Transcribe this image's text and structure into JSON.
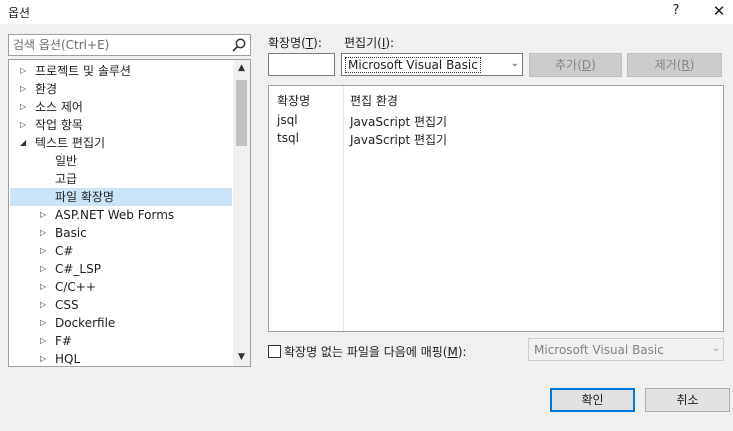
{
  "window": {
    "title": "옵션",
    "help_label": "?",
    "close_label": "✕"
  },
  "search": {
    "placeholder": "검색 옵션(Ctrl+E)",
    "value": ""
  },
  "tree": {
    "items": [
      {
        "label": "프로젝트 및 솔루션",
        "expanded": false,
        "level": 0
      },
      {
        "label": "환경",
        "expanded": false,
        "level": 0
      },
      {
        "label": "소스 제어",
        "expanded": false,
        "level": 0
      },
      {
        "label": "작업 항목",
        "expanded": false,
        "level": 0
      },
      {
        "label": "텍스트 편집기",
        "expanded": true,
        "level": 0
      },
      {
        "label": "일반",
        "level": 1
      },
      {
        "label": "고급",
        "level": 1
      },
      {
        "label": "파일 확장명",
        "level": 1,
        "selected": true
      },
      {
        "label": "ASP.NET Web Forms",
        "expanded": false,
        "level": 1
      },
      {
        "label": "Basic",
        "expanded": false,
        "level": 1
      },
      {
        "label": "C#",
        "expanded": false,
        "level": 1
      },
      {
        "label": "C#_LSP",
        "expanded": false,
        "level": 1
      },
      {
        "label": "C/C++",
        "expanded": false,
        "level": 1
      },
      {
        "label": "CSS",
        "expanded": false,
        "level": 1
      },
      {
        "label": "Dockerfile",
        "expanded": false,
        "level": 1
      },
      {
        "label": "F#",
        "expanded": false,
        "level": 1
      },
      {
        "label": "HQL",
        "expanded": false,
        "level": 1
      }
    ]
  },
  "extension_field": {
    "label": "확장명",
    "accel": "T",
    "value": ""
  },
  "editor_field": {
    "label": "편집기",
    "accel": "I",
    "value": "Microsoft Visual Basic"
  },
  "buttons": {
    "add": {
      "label": "추가",
      "accel": "D"
    },
    "remove": {
      "label": "제거",
      "accel": "R"
    },
    "ok": "확인",
    "cancel": "취소"
  },
  "ext_table": {
    "headers": [
      "확장명",
      "편집 환경"
    ],
    "rows": [
      [
        "jsql",
        "JavaScript 편집기"
      ],
      [
        "tsql",
        "JavaScript 편집기"
      ]
    ]
  },
  "map_option": {
    "label": "확장명 없는 파일을 다음에 매핑",
    "accel": "M",
    "checked": false,
    "value": "Microsoft Visual Basic"
  },
  "colors": {
    "selection": "#cce4f7",
    "accent": "#0078d7",
    "disabled_text": "#838383"
  }
}
